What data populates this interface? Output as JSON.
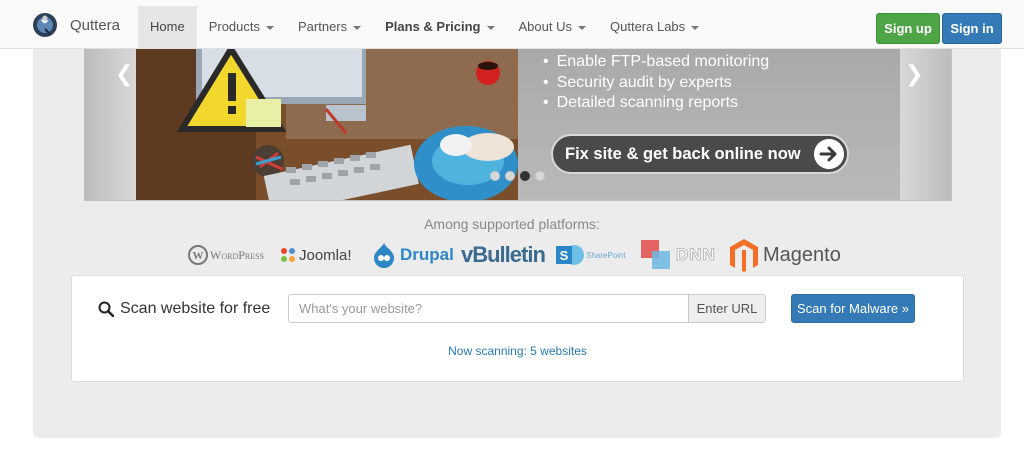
{
  "brand": {
    "name": "Quttera",
    "logo_icon": "globe-logo-icon"
  },
  "nav": {
    "items": [
      {
        "label": "Home",
        "active": true,
        "dropdown": false
      },
      {
        "label": "Products",
        "dropdown": true
      },
      {
        "label": "Partners",
        "dropdown": true
      },
      {
        "label": "Plans & Pricing",
        "dropdown": true,
        "bold": true
      },
      {
        "label": "About Us",
        "dropdown": true
      },
      {
        "label": "Quttera Labs",
        "dropdown": true
      }
    ],
    "signup_label": "Sign up",
    "signin_label": "Sign in"
  },
  "carousel": {
    "bullets": [
      "Enable FTP-based monitoring",
      "Security audit by experts",
      "Detailed scanning reports"
    ],
    "cta_label": "Fix site & get back online now",
    "prev_icon": "chevron-left-icon",
    "next_icon": "chevron-right-icon",
    "slide_count": 4,
    "active_slide": 3
  },
  "platforms": {
    "title": "Among supported platforms:",
    "logos": [
      "WordPress",
      "Joomla!",
      "Drupal",
      "vBulletin",
      "SharePoint",
      "DNN",
      "Magento"
    ]
  },
  "scan": {
    "label": "Scan website for free",
    "input_placeholder": "What's your website?",
    "input_value": "",
    "addon_label": "Enter URL",
    "button_label": "Scan for Malware »",
    "status": "Now scanning: 5 websites"
  },
  "colors": {
    "signup": "#4ea547",
    "signin": "#337ab7",
    "panel": "#ececec",
    "link": "#2a7ab9"
  }
}
